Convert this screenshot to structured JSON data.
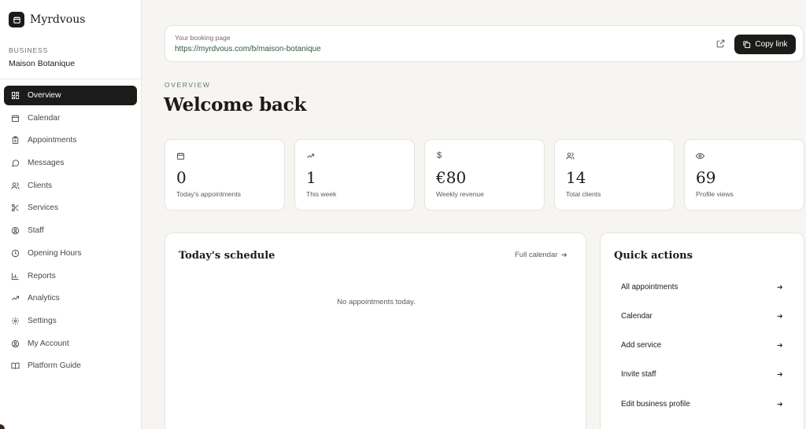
{
  "brand": {
    "name": "Myrdvous"
  },
  "business": {
    "label": "BUSINESS",
    "name": "Maison Botanique"
  },
  "nav": [
    {
      "label": "Overview",
      "icon": "grid-icon",
      "active": true
    },
    {
      "label": "Calendar",
      "icon": "calendar-icon"
    },
    {
      "label": "Appointments",
      "icon": "clipboard-icon"
    },
    {
      "label": "Messages",
      "icon": "chat-icon"
    },
    {
      "label": "Clients",
      "icon": "users-icon"
    },
    {
      "label": "Services",
      "icon": "scissors-icon"
    },
    {
      "label": "Staff",
      "icon": "user-circle-icon"
    },
    {
      "label": "Opening Hours",
      "icon": "clock-icon"
    },
    {
      "label": "Reports",
      "icon": "bar-chart-icon"
    },
    {
      "label": "Analytics",
      "icon": "trending-up-icon"
    },
    {
      "label": "Settings",
      "icon": "gear-icon"
    },
    {
      "label": "My Account",
      "icon": "account-icon"
    },
    {
      "label": "Platform Guide",
      "icon": "book-icon"
    }
  ],
  "booking": {
    "label": "Your booking page",
    "url": "https://myrdvous.com/b/maison-botanique",
    "copy_label": "Copy link"
  },
  "overview": {
    "overline": "OVERVIEW",
    "title": "Welcome back"
  },
  "stats": [
    {
      "value": "0",
      "label": "Today's appointments",
      "icon": "calendar-icon"
    },
    {
      "value": "1",
      "label": "This week",
      "icon": "trending-up-icon"
    },
    {
      "value": "€80",
      "label": "Weekly revenue",
      "icon": "dollar-icon",
      "icon_text": "$"
    },
    {
      "value": "14",
      "label": "Total clients",
      "icon": "users-icon"
    },
    {
      "value": "69",
      "label": "Profile views",
      "icon": "eye-icon"
    }
  ],
  "schedule": {
    "title": "Today's schedule",
    "link": "Full calendar",
    "empty": "No appointments today."
  },
  "quick_actions": {
    "title": "Quick actions",
    "items": [
      "All appointments",
      "Calendar",
      "Add service",
      "Invite staff",
      "Edit business profile"
    ]
  },
  "colors": {
    "accent_dark": "#1c1b19",
    "link_green": "#2f5a3e",
    "background": "#f6f5f2"
  }
}
